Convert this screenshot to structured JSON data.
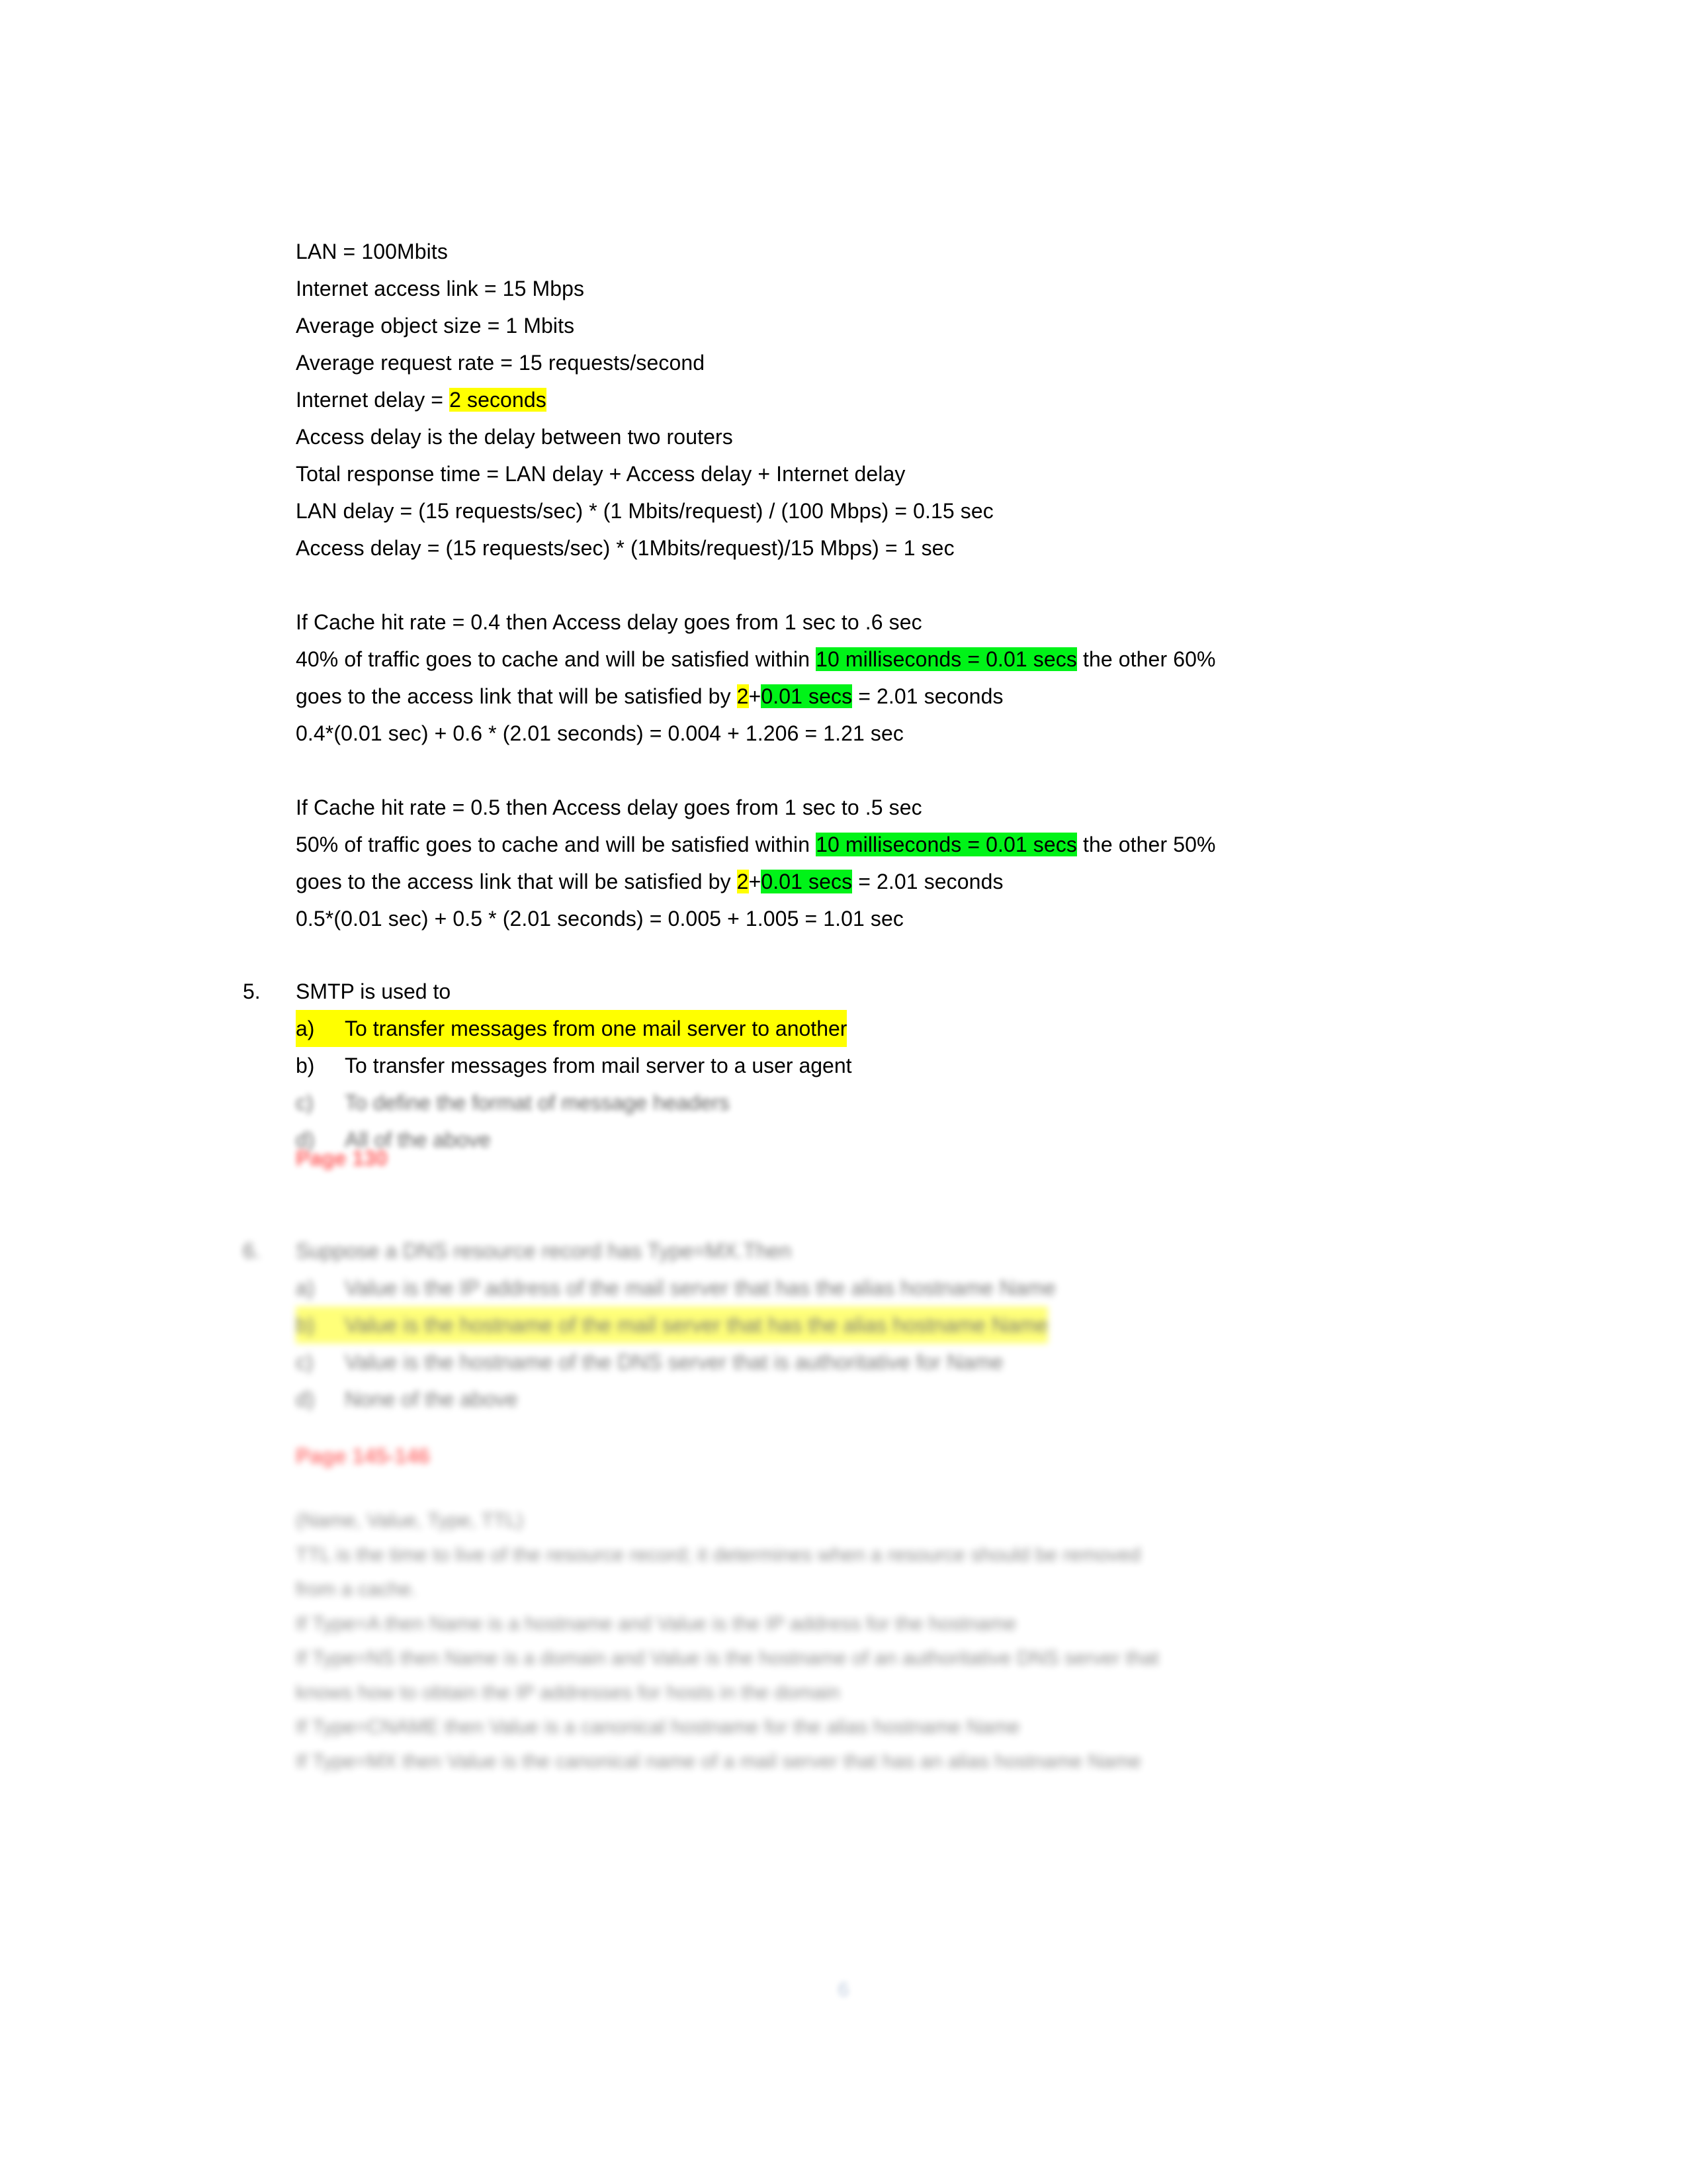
{
  "document": {
    "page_number": "6"
  },
  "colors": {
    "highlight_yellow": "#ffff00",
    "highlight_green": "#00f318",
    "red_text": "#ff0000",
    "page_number": "#4a6fa5"
  },
  "parameters": {
    "lines": [
      "LAN = 100Mbits",
      "Internet access link = 15 Mbps",
      "Average object size = 1 Mbits",
      "Average request rate = 15 requests/second"
    ],
    "internet_delay_prefix": "Internet delay = ",
    "internet_delay_value": "2 seconds",
    "access_delay_definition": "Access delay is the delay between two routers",
    "total_response_time": "Total response time = LAN delay + Access delay + Internet delay",
    "lan_delay_formula": "LAN delay = (15 requests/sec) * (1 Mbits/request) / (100 Mbps) = 0.15 sec",
    "access_delay_formula": "Access delay = (15 requests/sec) * (1Mbits/request)/15 Mbps) = 1 sec"
  },
  "case_04": {
    "intro": "If Cache hit rate = 0.4 then Access delay goes from 1 sec to .6 sec",
    "traffic_prefix": "40% of traffic goes to cache and will be satisfied within ",
    "cache_time": "10 milliseconds = 0.01 secs",
    "traffic_suffix": " the other 60%",
    "access_prefix": "goes to the access link that will be satisfied by ",
    "access_base": "2",
    "access_plus": "+",
    "access_add": "0.01 secs",
    "access_suffix": " = 2.01 seconds",
    "result": "0.4*(0.01 sec) + 0.6 * (2.01 seconds) = 0.004 + 1.206 = 1.21 sec"
  },
  "case_05": {
    "intro": "If Cache hit rate = 0.5 then Access delay goes from 1 sec to .5 sec",
    "traffic_prefix": "50% of traffic goes to cache and will be satisfied within ",
    "cache_time": "10 milliseconds = 0.01 secs",
    "traffic_suffix": " the other 50%",
    "access_prefix": "goes to the access link that will be satisfied by ",
    "access_base": "2",
    "access_plus": "+",
    "access_add": "0.01 secs",
    "access_suffix": " = 2.01 seconds",
    "result": "0.5*(0.01 sec) + 0.5 * (2.01 seconds) = 0.005 + 1.005 = 1.01 sec"
  },
  "question5": {
    "number": "5.",
    "prompt": "SMTP is used to",
    "options": [
      {
        "label": "a)",
        "text": "To transfer messages from one mail server to another",
        "highlighted": true
      },
      {
        "label": "b)",
        "text": "To transfer messages from mail server to a user agent",
        "highlighted": false
      },
      {
        "label": "c)",
        "text": "To define the format of message headers",
        "highlighted": false
      },
      {
        "label": "d)",
        "text": "All of the above",
        "highlighted": false
      }
    ],
    "reference": "Page 130"
  },
  "question6": {
    "number": "6.",
    "prompt": "Suppose a DNS resource record has Type=MX.Then",
    "options": [
      {
        "label": "a)",
        "text": "Value is the IP address of the mail server that has the alias hostname Name",
        "highlighted": false
      },
      {
        "label": "b)",
        "text": "Value is the hostname of the mail server that has the alias hostname Name",
        "highlighted": true
      },
      {
        "label": "c)",
        "text": "Value is the hostname of the DNS server that is authoritative for Name",
        "highlighted": false
      },
      {
        "label": "d)",
        "text": "None of the above",
        "highlighted": false
      }
    ],
    "reference": "Page 145-146"
  },
  "notes": {
    "lines": [
      "(Name, Value, Type, TTL)",
      "TTL is the time to live of the resource record; it determines when a resource should be removed",
      "from a cache.",
      "If Type=A then Name is a hostname and Value is the IP address for the hostname",
      "If Type=NS then Name is a domain and Value is the hostname of an authoritative DNS server that",
      "knows how to obtain the IP addresses for hosts in the domain",
      "If Type=CNAME then Value is a canonical hostname for the alias hostname Name",
      "If Type=MX then Value is the canonical name of a mail server that has an alias hostname Name"
    ]
  }
}
